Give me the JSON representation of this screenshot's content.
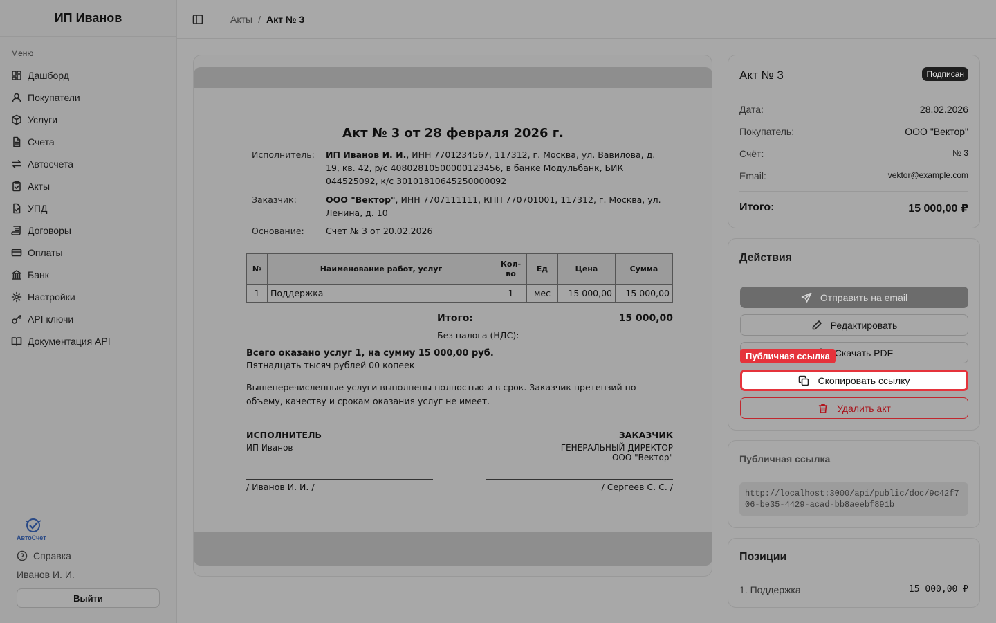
{
  "brand": "ИП Иванов",
  "sidebar": {
    "menu_label": "Меню",
    "items": [
      {
        "label": "Дашборд",
        "icon": "dashboard-icon"
      },
      {
        "label": "Покупатели",
        "icon": "user-icon"
      },
      {
        "label": "Услуги",
        "icon": "box-icon"
      },
      {
        "label": "Счета",
        "icon": "file-icon"
      },
      {
        "label": "Автосчета",
        "icon": "repeat-icon"
      },
      {
        "label": "Акты",
        "icon": "clipboard-icon"
      },
      {
        "label": "УПД",
        "icon": "file-check-icon"
      },
      {
        "label": "Договоры",
        "icon": "scroll-icon"
      },
      {
        "label": "Оплаты",
        "icon": "credit-card-icon"
      },
      {
        "label": "Банк",
        "icon": "bank-icon"
      },
      {
        "label": "Настройки",
        "icon": "gear-icon"
      },
      {
        "label": "API ключи",
        "icon": "key-icon"
      },
      {
        "label": "Документация API",
        "icon": "book-icon"
      }
    ],
    "logo_text": "АвтоСчет",
    "help": "Справка",
    "user": "Иванов И. И.",
    "logout": "Выйти"
  },
  "breadcrumb": {
    "parent": "Акты",
    "sep": "/",
    "current": "Акт № 3"
  },
  "document": {
    "title": "Акт № 3 от 28 февраля 2026 г.",
    "executor_label": "Исполнитель:",
    "executor_name": "ИП Иванов И. И.",
    "executor_details": ", ИНН 7701234567, 117312, г. Москва, ул. Вавилова, д. 19, кв. 42, р/с 40802810500000123456, в банке Модульбанк, БИК 044525092, к/с 30101810645250000092",
    "customer_label": "Заказчик:",
    "customer_name": "ООО \"Вектор\"",
    "customer_details": ", ИНН 7707111111, КПП 770701001, 117312, г. Москва, ул. Ленина, д. 10",
    "basis_label": "Основание:",
    "basis": "Счет № 3 от 20.02.2026",
    "table": {
      "headers": [
        "№",
        "Наименование работ, услуг",
        "Кол-во",
        "Ед",
        "Цена",
        "Сумма"
      ],
      "rows": [
        [
          "1",
          "Поддержка",
          "1",
          "мес",
          "15 000,00",
          "15 000,00"
        ]
      ]
    },
    "total_label": "Итого:",
    "total_value": "15 000,00",
    "vat_label": "Без налога (НДС):",
    "vat_value": "—",
    "summary": "Всего оказано услуг 1, на сумму 15 000,00 руб.",
    "summary_words": "Пятнадцать тысяч рублей 00 копеек",
    "statement": "Вышеперечисленные услуги выполнены полностью и в срок. Заказчик претензий по объему, качеству и срокам оказания услуг не имеет.",
    "executor_sign_title": "ИСПОЛНИТЕЛЬ",
    "executor_sign_sub": "ИП Иванов",
    "customer_sign_title": "ЗАКАЗЧИК",
    "customer_sign_role": "ГЕНЕРАЛЬНЫЙ ДИРЕКТОР",
    "customer_sign_org": "ООО \"Вектор\"",
    "executor_sign_name": "/ Иванов И. И. /",
    "customer_sign_name": "/ Сергеев С. С. /"
  },
  "info": {
    "title": "Акт № 3",
    "status": "Подписан",
    "date_label": "Дата:",
    "date": "28.02.2026",
    "buyer_label": "Покупатель:",
    "buyer": "ООО \"Вектор\"",
    "invoice_label": "Счёт:",
    "invoice": "№ 3",
    "email_label": "Email:",
    "email": "vektor@example.com",
    "total_label": "Итого:",
    "total": "15 000,00 ₽"
  },
  "actions": {
    "title": "Действия",
    "send_email": "Отправить на email",
    "edit": "Редактировать",
    "download_pdf": "Скачать PDF",
    "copy_link": "Скопировать ссылку",
    "delete": "Удалить акт",
    "tooltip": "Публичная ссылка"
  },
  "public_link": {
    "title": "Публичная ссылка",
    "url": "http://localhost:3000/api/public/doc/9c42f706-be35-4429-acad-bb8aeebf891b"
  },
  "positions": {
    "title": "Позиции",
    "items": [
      {
        "name": "1. Поддержка",
        "amount": "15 000,00 ₽"
      }
    ]
  },
  "colors": {
    "accent_red": "#e5333b",
    "badge": "#1e1e1e",
    "overlay": "#a8a8a8"
  }
}
